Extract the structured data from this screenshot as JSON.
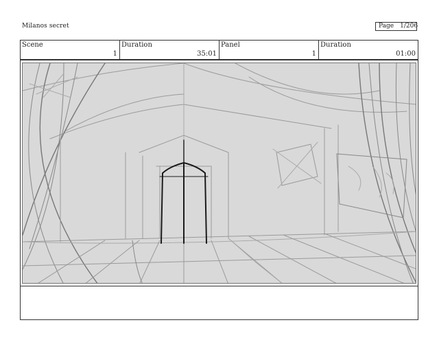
{
  "header": {
    "project_title": "Milanos secret",
    "page_label": "Page",
    "page_value": "1/206"
  },
  "info_row": {
    "scene_label": "Scene",
    "scene_value": "1",
    "duration1_label": "Duration",
    "duration1_value": "35:01",
    "panel_label": "Panel",
    "panel_value": "1",
    "duration2_label": "Duration",
    "duration2_value": "01:00"
  },
  "panel": {
    "sketch_desc": "pencil sketch of tent interior with doorway",
    "notes": ""
  }
}
